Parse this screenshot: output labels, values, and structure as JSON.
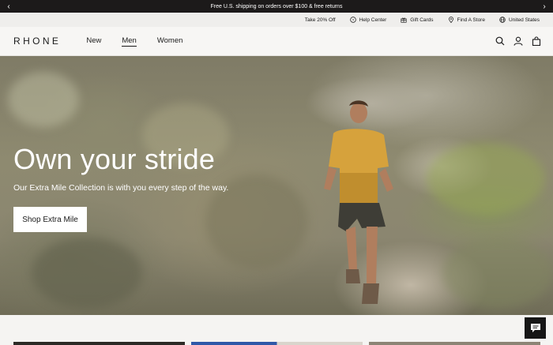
{
  "announcement": {
    "text": "Free U.S. shipping on orders over $100 & free returns",
    "prev_icon": "chevron-left-icon",
    "next_icon": "chevron-right-icon"
  },
  "utility": {
    "discount": "Take 20% Off",
    "help": "Help Center",
    "gift": "Gift Cards",
    "store": "Find A Store",
    "region": "United States"
  },
  "nav": {
    "logo": "RHONE",
    "links": [
      "New",
      "Men",
      "Women"
    ],
    "active": "Men"
  },
  "hero": {
    "title": "Own your stride",
    "subtitle": "Our Extra Mile Collection is with you every step of the way.",
    "cta": "Shop Extra Mile"
  },
  "colors": {
    "announcement_bg": "#1c1a1a",
    "chat_bg": "#161616"
  }
}
